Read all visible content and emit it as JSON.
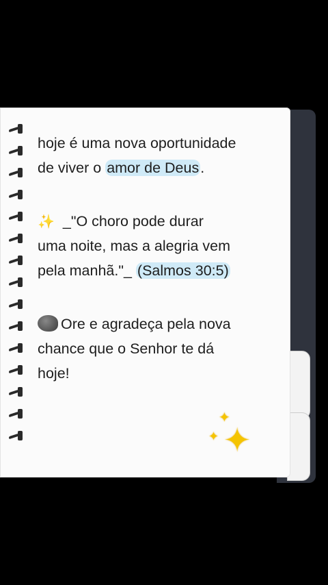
{
  "note": {
    "line1": "hoje é uma nova oportunidade",
    "line2_prefix": "de viver o ",
    "line2_highlight": "amor de Deus",
    "line2_suffix": ".",
    "quote_icon": "sparkles-icon",
    "quote_text_a": "_\"O choro pode durar",
    "quote_text_b": "uma noite, mas a alegria vem",
    "quote_text_c": "pela manhã.\"_ ",
    "quote_ref": "(Salmos 30:5)",
    "prayer_icon": "rock-icon",
    "prayer_a": "Ore e agradeça pela nova",
    "prayer_b": "chance que o Senhor te dá",
    "prayer_c": "hoje!",
    "decoration_icon": "sparkles-icon"
  }
}
